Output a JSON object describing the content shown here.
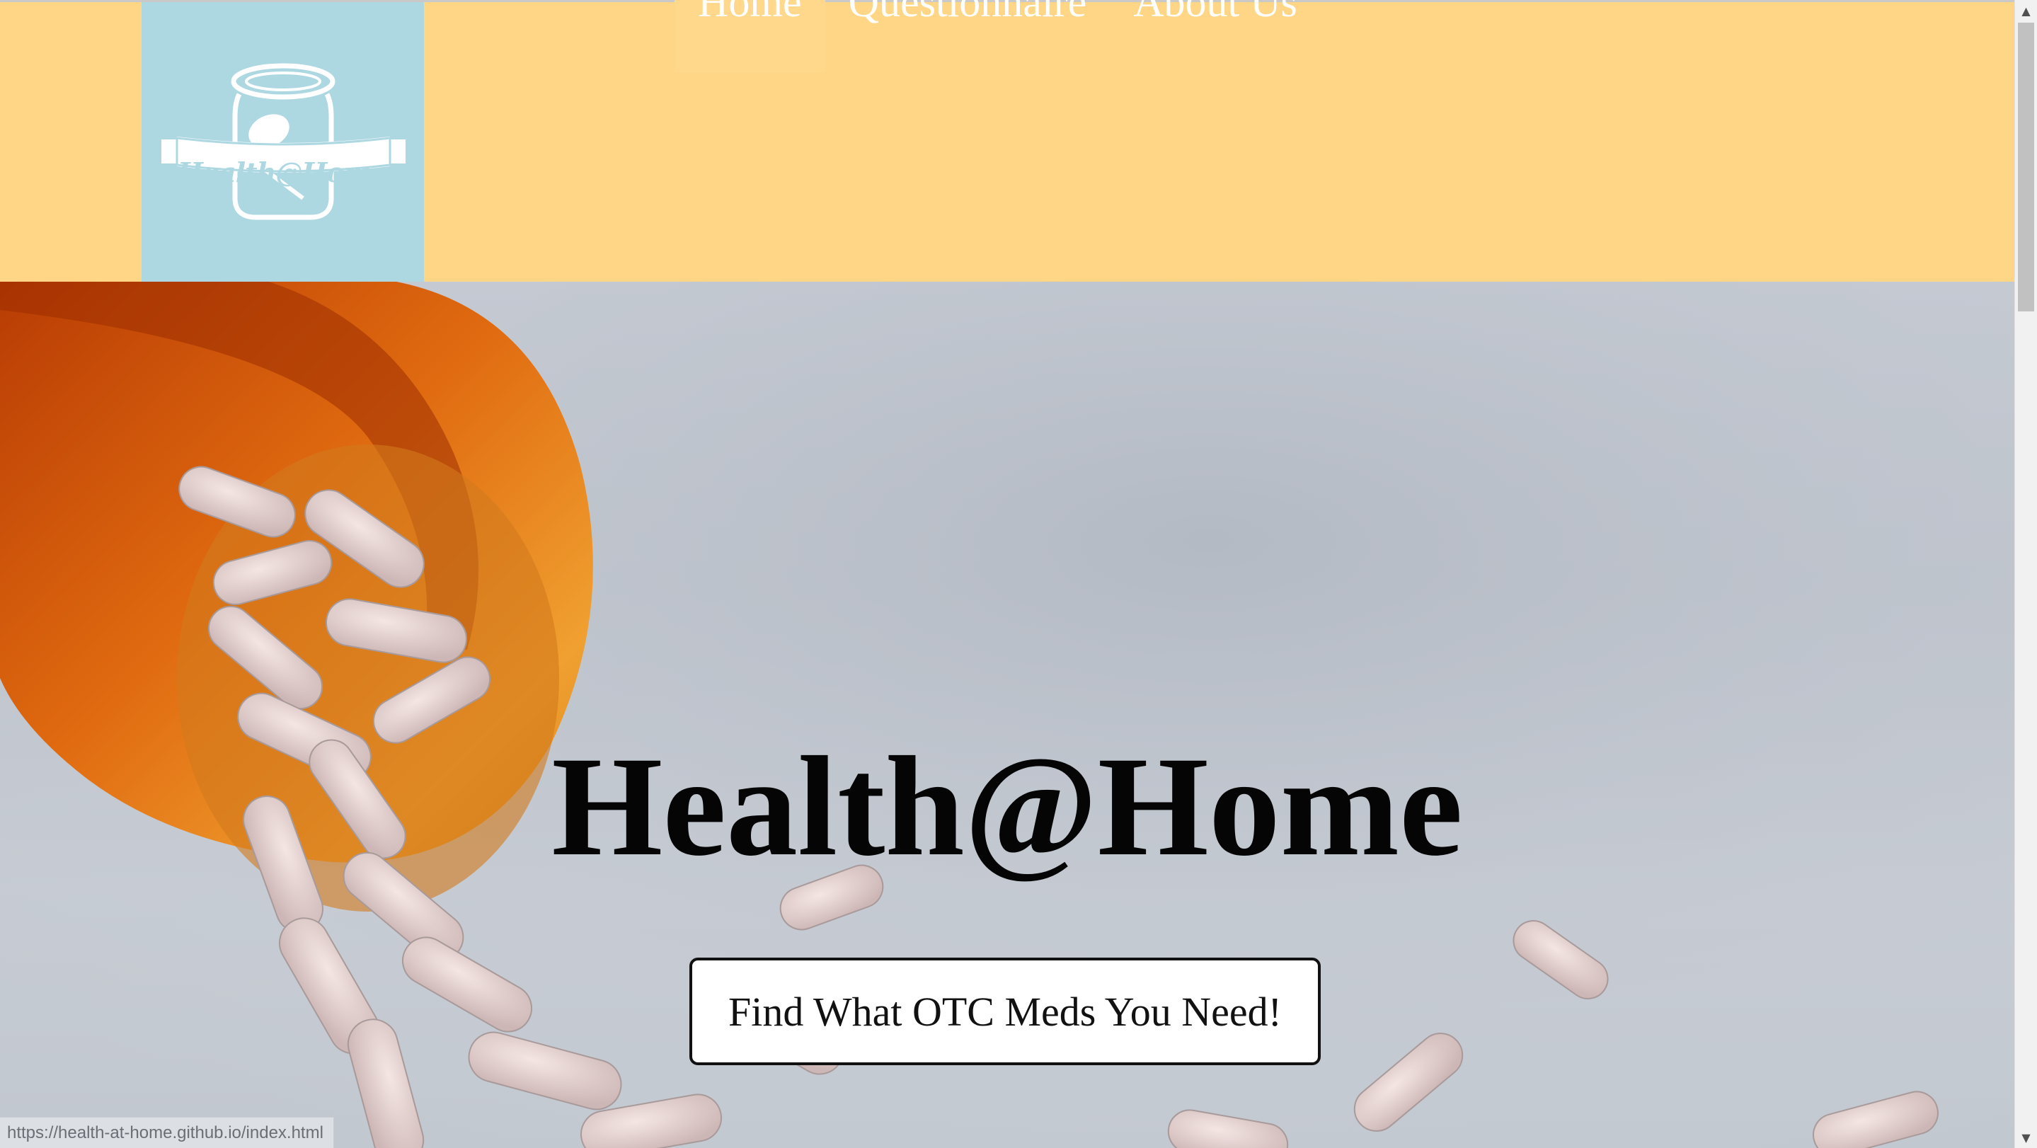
{
  "header": {
    "logo_text": "Health@Home",
    "nav": [
      {
        "label": "Home",
        "active": true
      },
      {
        "label": "Questionnaire",
        "active": false
      },
      {
        "label": "About Us",
        "active": false
      }
    ],
    "colors": {
      "header_bg": "#ffd685",
      "logo_bg": "#add8e2",
      "nav_text": "#ffffff"
    }
  },
  "hero": {
    "title": "Health@Home",
    "cta_label": "Find What OTC Meds You Need!",
    "background_description_icon": "pill-bottle-spilling-pills"
  },
  "status_bar": {
    "url": "https://health-at-home.github.io/index.html"
  },
  "scrollbar": {
    "up_icon": "chevron-up-icon",
    "down_icon": "chevron-down-icon",
    "position_fraction": 0.0
  }
}
